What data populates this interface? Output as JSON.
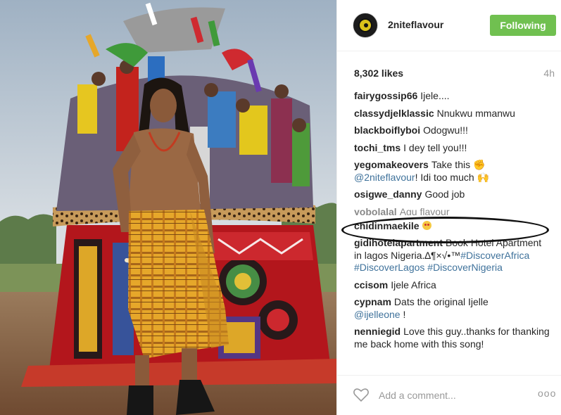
{
  "post": {
    "username": "2niteflavour",
    "follow_label": "Following",
    "likes": "8,302 likes",
    "time": "4h"
  },
  "comments": [
    {
      "user": "fairygossip66",
      "text": "Ijele...."
    },
    {
      "user": "classydjelklassic",
      "text": "Nnukwu mmanwu"
    },
    {
      "user": "blackboiflyboi",
      "text": "Odogwu!!!"
    },
    {
      "user": "tochi_tms",
      "text": "I dey tell you!!!"
    },
    {
      "user": "yegomakeovers",
      "text": "Take this",
      "mention": "@2niteflavour",
      "text2": "! Idi too much"
    },
    {
      "user": "osigwe_danny",
      "text": "Good job"
    },
    {
      "user": "yobolalal",
      "text": "Agu flavour"
    },
    {
      "user": "chidinmaekile",
      "text": ""
    },
    {
      "user": "gidihotelapartment",
      "text": "Book Hotel Apartment in lagos Nigeria.∆¶×√•™",
      "tags": [
        "#DiscoverAfrica",
        "#DiscoverLagos",
        "#DiscoverNigeria"
      ]
    },
    {
      "user": "ccisom",
      "text": "Ijele Africa"
    },
    {
      "user": "cypnam",
      "text": "Dats the original Ijelle",
      "mention": "@ijelleone",
      "text2": " !"
    },
    {
      "user": "nenniegid",
      "text": "Love this guy..thanks for thanking me back home with this song!"
    }
  ],
  "footer": {
    "placeholder": "Add a comment...",
    "more_label": "ooo"
  },
  "icons": {
    "like": "heart-outline-icon",
    "more": "more-options-icon"
  },
  "colors": {
    "follow_button": "#70c050",
    "mention": "#3f729b",
    "muted": "#999999"
  }
}
